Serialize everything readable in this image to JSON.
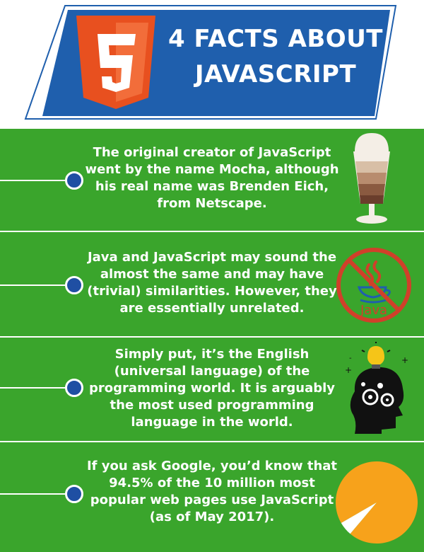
{
  "header": {
    "title_line1": "4 FACTS ABOUT",
    "title_line2": "JAVASCRIPT",
    "logo_number": "5",
    "colors": {
      "banner": "#1f5fad",
      "logo_orange": "#e8501f",
      "logo_light": "#f26d3a"
    }
  },
  "background": "#3aa52c",
  "facts": [
    {
      "text": "The original creator of JavaScript went by the name Mocha, although his real name was Brenden Eich, from Netscape.",
      "icon": "latte-glass-icon"
    },
    {
      "text": "Java and JavaScript may sound the almost the same and may have (trivial) similarities. However, they are essentially unrelated.",
      "icon": "no-java-icon",
      "icon_label": "Java"
    },
    {
      "text": "Simply put, it’s the English (universal language) of the programming world. It is arguably the most used programming language in the world.",
      "icon": "head-lightbulb-gears-icon"
    },
    {
      "text": "If you ask Google, you’d know that 94.5% of the 10 million most popular web pages use JavaScript (as of May 2017).",
      "icon": "pie-chart-icon",
      "share_percent": 94.5
    }
  ]
}
